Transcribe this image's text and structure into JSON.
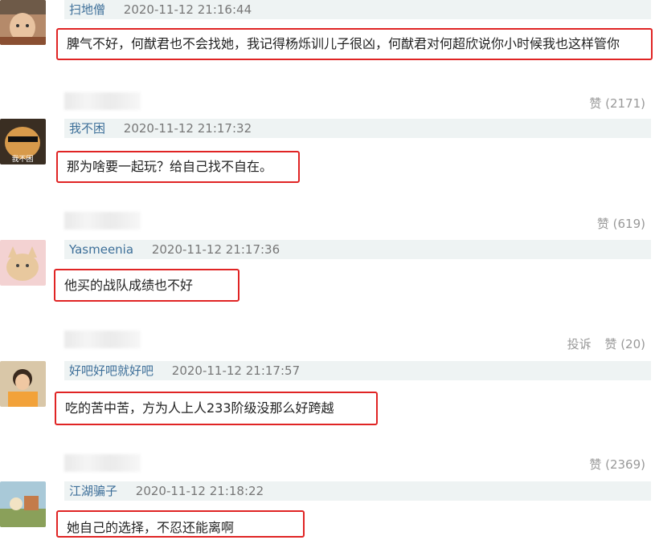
{
  "comments": [
    {
      "user": "扫地僧",
      "time": "2020-11-12 21:16:44",
      "text": "脾气不好，何猷君也不会找她，我记得杨烁训儿子很凶，何猷君对何超欣说你小时候我也这样管你"
    },
    {
      "user": "我不困",
      "time": "2020-11-12 21:17:32",
      "text": "那为啥要一起玩？给自己找不自在。",
      "avatar_text": "我不困"
    },
    {
      "user": "Yasmeenia",
      "time": "2020-11-12 21:17:36",
      "text": "他买的战队成绩也不好"
    },
    {
      "user": "好吧好吧就好吧",
      "time": "2020-11-12 21:17:57",
      "text": "吃的苦中苦，方为人上人233阶级没那么好跨越"
    },
    {
      "user": "江湖骗子",
      "time": "2020-11-12 21:18:22",
      "text": "她自己的选择，不忍还能离啊"
    }
  ],
  "reply_rows": [
    {
      "like_label": "赞 (2171)"
    },
    {
      "like_label": "赞 (619)"
    },
    {
      "report_label": "投诉",
      "like_label": "赞 (20)"
    },
    {
      "like_label": "赞 (2369)"
    }
  ],
  "colors": {
    "border": "#e02424",
    "username": "#3d6f99",
    "meta_bg": "#eef3f3"
  }
}
